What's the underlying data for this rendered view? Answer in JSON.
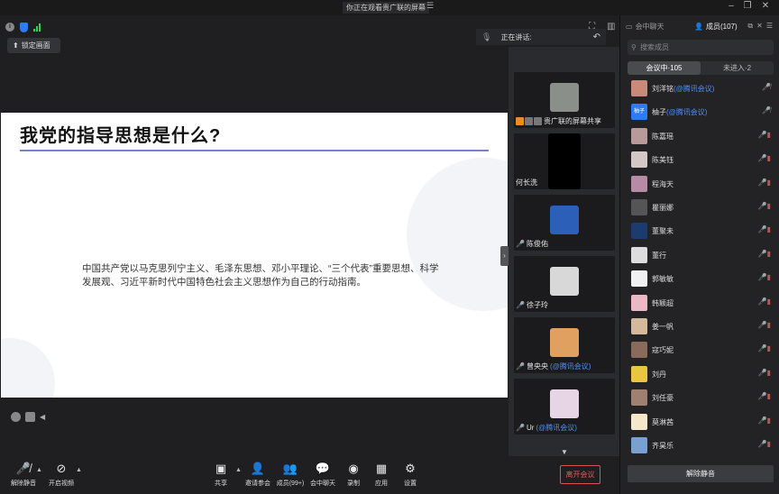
{
  "window": {
    "title": "你正在观看贵广联的屏幕"
  },
  "header": {
    "lock_label": "锁定画面",
    "speaking_label": "正在讲话:"
  },
  "slide": {
    "title": "我党的指导思想是什么?",
    "body": "中国共产党以马克思列宁主义、毛泽东思想、邓小平理论、“三个代表”重要思想、科学发展观、习近平新时代中国特色社会主义思想作为自己的行动指南。"
  },
  "video_tiles": [
    {
      "name": "贵广联的屏幕共享",
      "color": "#8a8f8a",
      "sharing": true
    },
    {
      "name": "何长洗",
      "color": "#000000"
    },
    {
      "name": "陈俊佑",
      "color": "#2c5fb8"
    },
    {
      "name": "徐子玲",
      "color": "#d8d8d8"
    },
    {
      "name": "曾央央",
      "tag": "(@腾讯会议)",
      "color": "#e0a060"
    },
    {
      "name": "Ur",
      "tag": "(@腾讯会议)",
      "color": "#e7d5e6"
    }
  ],
  "toolbar": {
    "unmute": "解除静音",
    "start_video": "开启视频",
    "share": "共享",
    "invite": "邀请参会",
    "members": "成员(99+)",
    "chat": "会中聊天",
    "record": "录制",
    "apps": "应用",
    "settings": "设置",
    "leave": "离开会议"
  },
  "right_panel": {
    "tab_chat": "会中聊天",
    "tab_members": "成员(107)",
    "search_placeholder": "搜索成员",
    "seg_in_meeting": "会议中·105",
    "seg_not_joined": "未进入·2",
    "unmute_all": "解除静音",
    "members": [
      {
        "name": "刘洋铭",
        "tag": "(@腾讯会议)",
        "color": "#c98a7a"
      },
      {
        "name": "柚子",
        "tag": "(@腾讯会议)",
        "color": "#2d7cf6",
        "avatar_text": "柚子"
      },
      {
        "name": "陈嘉瑶",
        "color": "#b99a9a"
      },
      {
        "name": "陈美钰",
        "color": "#d6c7c7"
      },
      {
        "name": "程海天",
        "color": "#b78aa5"
      },
      {
        "name": "瞿丽娜",
        "color": "#555555"
      },
      {
        "name": "董聚未",
        "color": "#1d3c6e"
      },
      {
        "name": "董行",
        "color": "#dddddd"
      },
      {
        "name": "郭敏敏",
        "color": "#f0f0f0"
      },
      {
        "name": "韩颖超",
        "color": "#e9b9c5"
      },
      {
        "name": "姜一帆",
        "color": "#d4ba9a"
      },
      {
        "name": "寇巧妮",
        "color": "#8a6a5a"
      },
      {
        "name": "刘丹",
        "color": "#e8c640"
      },
      {
        "name": "刘任豪",
        "color": "#a08070"
      },
      {
        "name": "莫淋茜",
        "color": "#f4e8c8"
      },
      {
        "name": "齐昊乐",
        "color": "#7aa0d0"
      }
    ]
  }
}
